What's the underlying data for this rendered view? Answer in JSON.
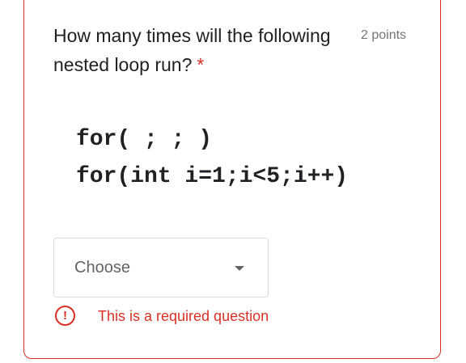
{
  "question": {
    "title": "How many times will the following nested loop run?",
    "required_marker": "*",
    "points": "2 points"
  },
  "code": {
    "line1": "for( ; ; )",
    "line2": "for(int i=1;i<5;i++)"
  },
  "dropdown": {
    "value": "Choose",
    "arrow_icon": "triangle-down-icon"
  },
  "error": {
    "icon": "exclamation-circle-icon",
    "icon_glyph": "!",
    "message": "This is a required question"
  },
  "colors": {
    "error": "#d93025",
    "text": "#202124",
    "muted": "#70757a",
    "border": "#dadce0"
  }
}
